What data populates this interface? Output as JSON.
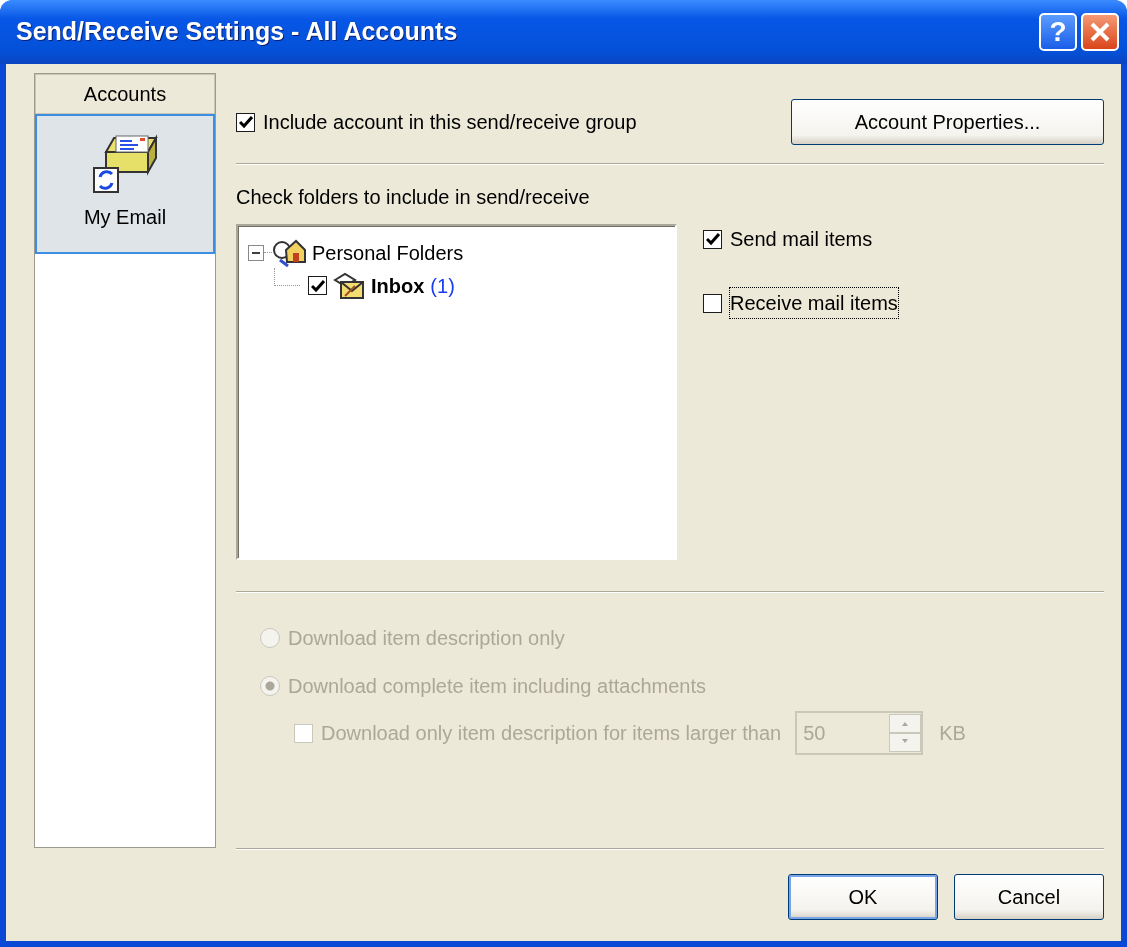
{
  "window": {
    "title": "Send/Receive Settings - All Accounts",
    "help": "?"
  },
  "sidebar": {
    "header": "Accounts",
    "items": [
      {
        "label": "My Email",
        "selected": true
      }
    ]
  },
  "include_account": {
    "label": "Include account in this send/receive group",
    "checked": true
  },
  "account_properties_button": "Account Properties...",
  "folders": {
    "label": "Check folders to include in send/receive",
    "tree": [
      {
        "label": "Personal Folders",
        "expanded": true,
        "children": [
          {
            "label": "Inbox",
            "count": "(1)",
            "checked": true
          }
        ]
      }
    ]
  },
  "mail_options": [
    {
      "label": "Send mail items",
      "checked": true,
      "focused": false
    },
    {
      "label": "Receive mail items",
      "checked": false,
      "focused": true
    }
  ],
  "download_options": {
    "disabled": true,
    "radios": [
      {
        "label": "Download item description only",
        "selected": false
      },
      {
        "label": "Download complete item including attachments",
        "selected": true
      }
    ],
    "size_limit": {
      "label": "Download only item description for items larger than",
      "checked": false,
      "value": "50",
      "unit": "KB"
    }
  },
  "buttons": [
    {
      "label": "OK",
      "default": true
    },
    {
      "label": "Cancel",
      "default": false
    }
  ]
}
